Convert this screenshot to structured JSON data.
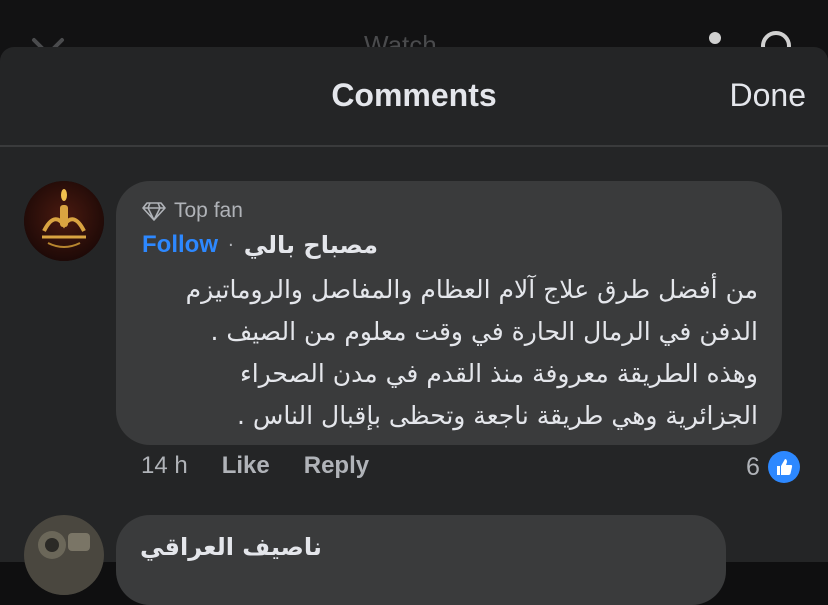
{
  "background": {
    "title": "Watch"
  },
  "sheet": {
    "title": "Comments",
    "done_label": "Done"
  },
  "comments": [
    {
      "badge": "Top fan",
      "follow_label": "Follow",
      "separator": "·",
      "author": "مصباح  بالي",
      "text_lines": [
        "من أفضل طرق علاج آلام العظام والمفاصل والروماتيزم",
        "الدفن في الرمال الحارة في وقت معلوم من الصيف .",
        "وهذه الطريقة معروفة منذ القدم في مدن الصحراء",
        "الجزائرية وهي طريقة ناجعة وتحظى بإقبال  الناس ."
      ],
      "time": "14 h",
      "like_label": "Like",
      "reply_label": "Reply",
      "reaction_count": "6",
      "avatar_text": "مصباح بالي"
    },
    {
      "author": "ناصيف العراقي"
    }
  ],
  "colors": {
    "accent": "#2d88ff",
    "sheet_bg": "#242526",
    "bubble_bg": "#3a3b3c"
  },
  "icons": [
    "close-icon",
    "person-icon",
    "search-icon",
    "diamond-icon",
    "like-icon"
  ]
}
